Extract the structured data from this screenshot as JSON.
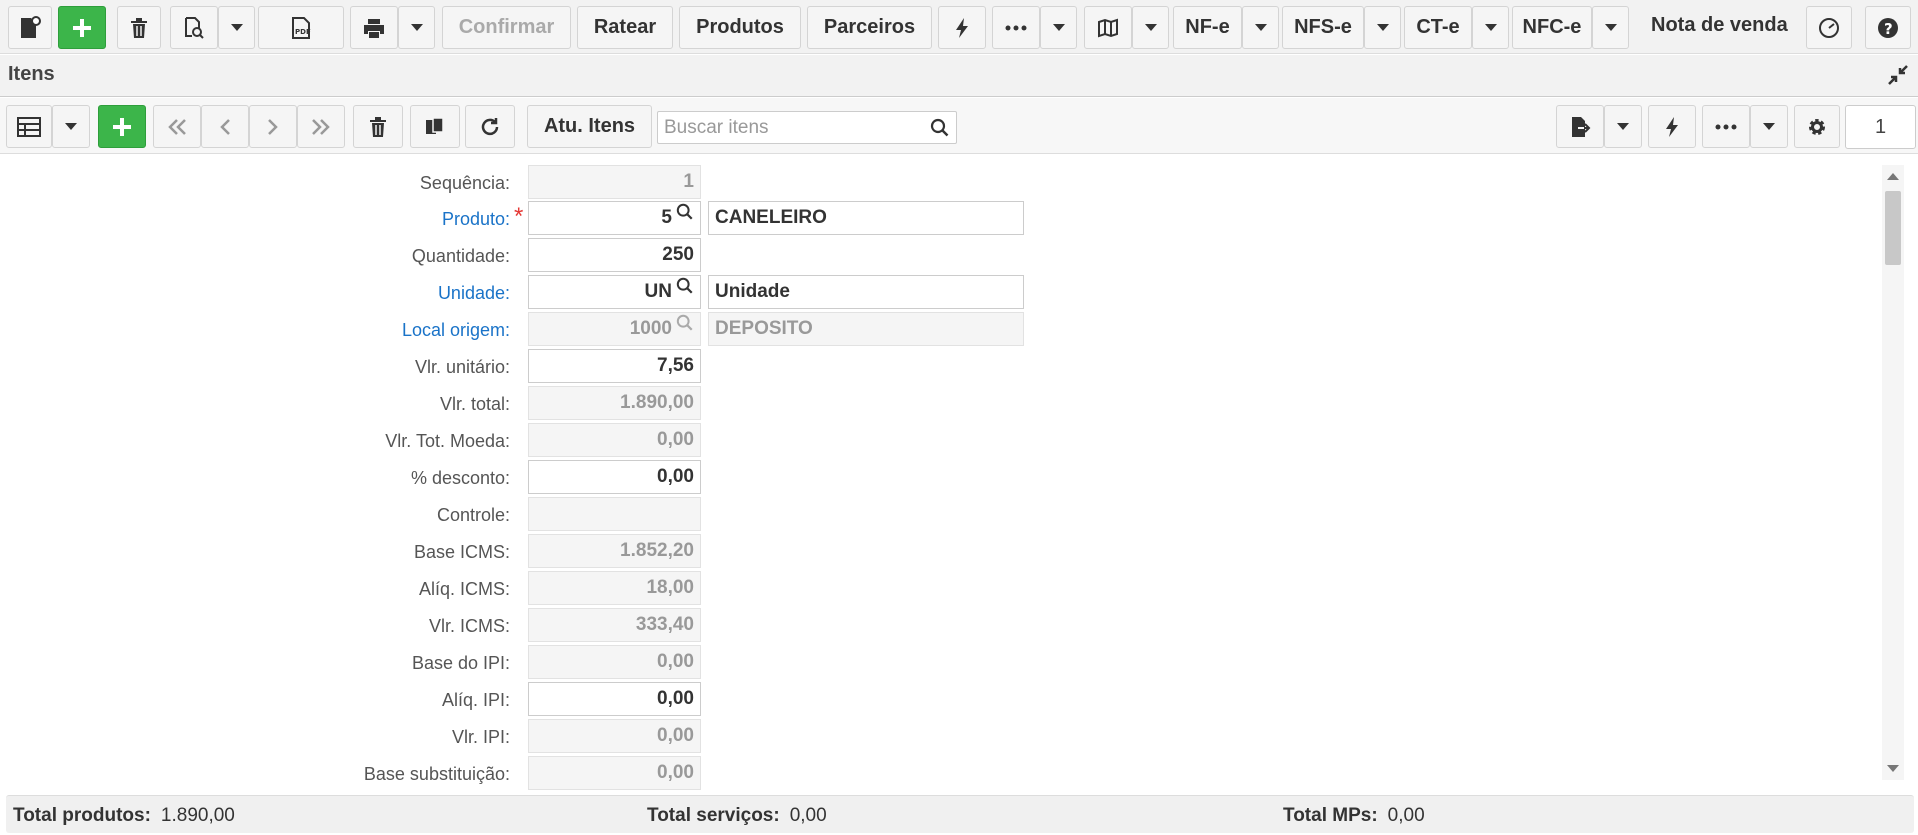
{
  "toolbar": {
    "confirm_label": "Confirmar",
    "ratear_label": "Ratear",
    "produtos_label": "Produtos",
    "parceiros_label": "Parceiros",
    "nfe_label": "NF-e",
    "nfse_label": "NFS-e",
    "cte_label": "CT-e",
    "nfce_label": "NFC-e",
    "title": "Nota de venda"
  },
  "panel": {
    "title": "Itens"
  },
  "items_toolbar": {
    "refresh_items_label": "Atu. Itens",
    "search_placeholder": "Buscar itens",
    "page": "1"
  },
  "form": {
    "sequencia": {
      "label": "Sequência:",
      "value": "1"
    },
    "produto": {
      "label": "Produto:",
      "code": "5",
      "description": "CANELEIRO"
    },
    "quantidade": {
      "label": "Quantidade:",
      "value": "250"
    },
    "unidade": {
      "label": "Unidade:",
      "code": "UN",
      "description": "Unidade"
    },
    "local_origem": {
      "label": "Local origem:",
      "code": "1000",
      "description": "DEPOSITO"
    },
    "vlr_unitario": {
      "label": "Vlr. unitário:",
      "value": "7,56"
    },
    "vlr_total": {
      "label": "Vlr. total:",
      "value": "1.890,00"
    },
    "vlr_tot_moeda": {
      "label": "Vlr. Tot. Moeda:",
      "value": "0,00"
    },
    "desconto": {
      "label": "% desconto:",
      "value": "0,00"
    },
    "controle": {
      "label": "Controle:",
      "value": ""
    },
    "base_icms": {
      "label": "Base ICMS:",
      "value": "1.852,20"
    },
    "aliq_icms": {
      "label": "Alíq. ICMS:",
      "value": "18,00"
    },
    "vlr_icms": {
      "label": "Vlr. ICMS:",
      "value": "333,40"
    },
    "base_ipi": {
      "label": "Base do IPI:",
      "value": "0,00"
    },
    "aliq_ipi": {
      "label": "Alíq. IPI:",
      "value": "0,00"
    },
    "vlr_ipi": {
      "label": "Vlr. IPI:",
      "value": "0,00"
    },
    "base_subst": {
      "label": "Base substituição:",
      "value": "0,00"
    }
  },
  "footer": {
    "total_produtos_label": "Total produtos:",
    "total_produtos_value": "1.890,00",
    "total_servicos_label": "Total serviços:",
    "total_servicos_value": "0,00",
    "total_mps_label": "Total MPs:",
    "total_mps_value": "0,00"
  },
  "colors": {
    "accent_green": "#3cb54a",
    "link_blue": "#1a73c8",
    "required_red": "#e53935"
  }
}
